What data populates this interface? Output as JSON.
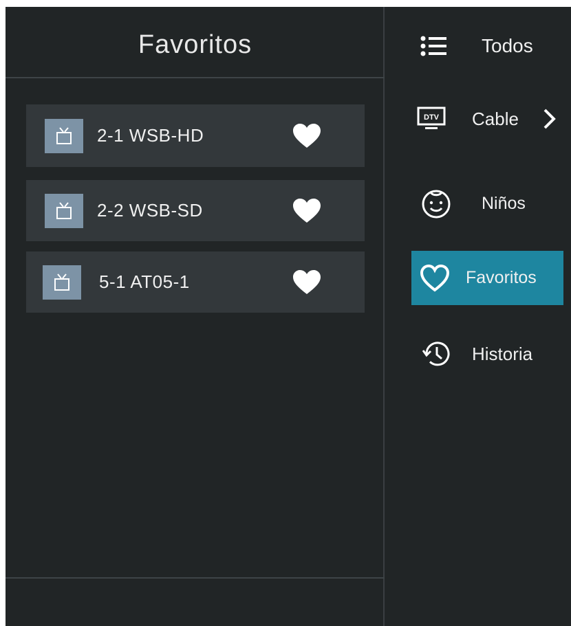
{
  "left_panel": {
    "title": "Favoritos",
    "channels": [
      {
        "label": "2-1 WSB-HD",
        "icon": "tv-icon",
        "favorite_icon": "heart-filled-icon"
      },
      {
        "label": "2-2 WSB-SD",
        "icon": "tv-icon",
        "favorite_icon": "heart-filled-icon"
      },
      {
        "label": "5-1 AT05-1",
        "icon": "tv-icon",
        "favorite_icon": "heart-filled-icon"
      }
    ]
  },
  "categories": [
    {
      "label": "Todos",
      "icon": "list-icon",
      "active": false
    },
    {
      "label": "Cable",
      "icon": "dtv-icon",
      "active": false,
      "has_submenu": true
    },
    {
      "label": "Niños",
      "icon": "kid-face-icon",
      "active": false
    },
    {
      "label": "Favoritos",
      "icon": "heart-outline-icon",
      "active": true
    },
    {
      "label": "Historia",
      "icon": "history-icon",
      "active": false
    }
  ],
  "colors": {
    "background": "#212526",
    "row_background": "#33383b",
    "channel_icon_background": "#7d93a6",
    "active_category": "#1e86a0",
    "text": "#f0f0f0"
  }
}
